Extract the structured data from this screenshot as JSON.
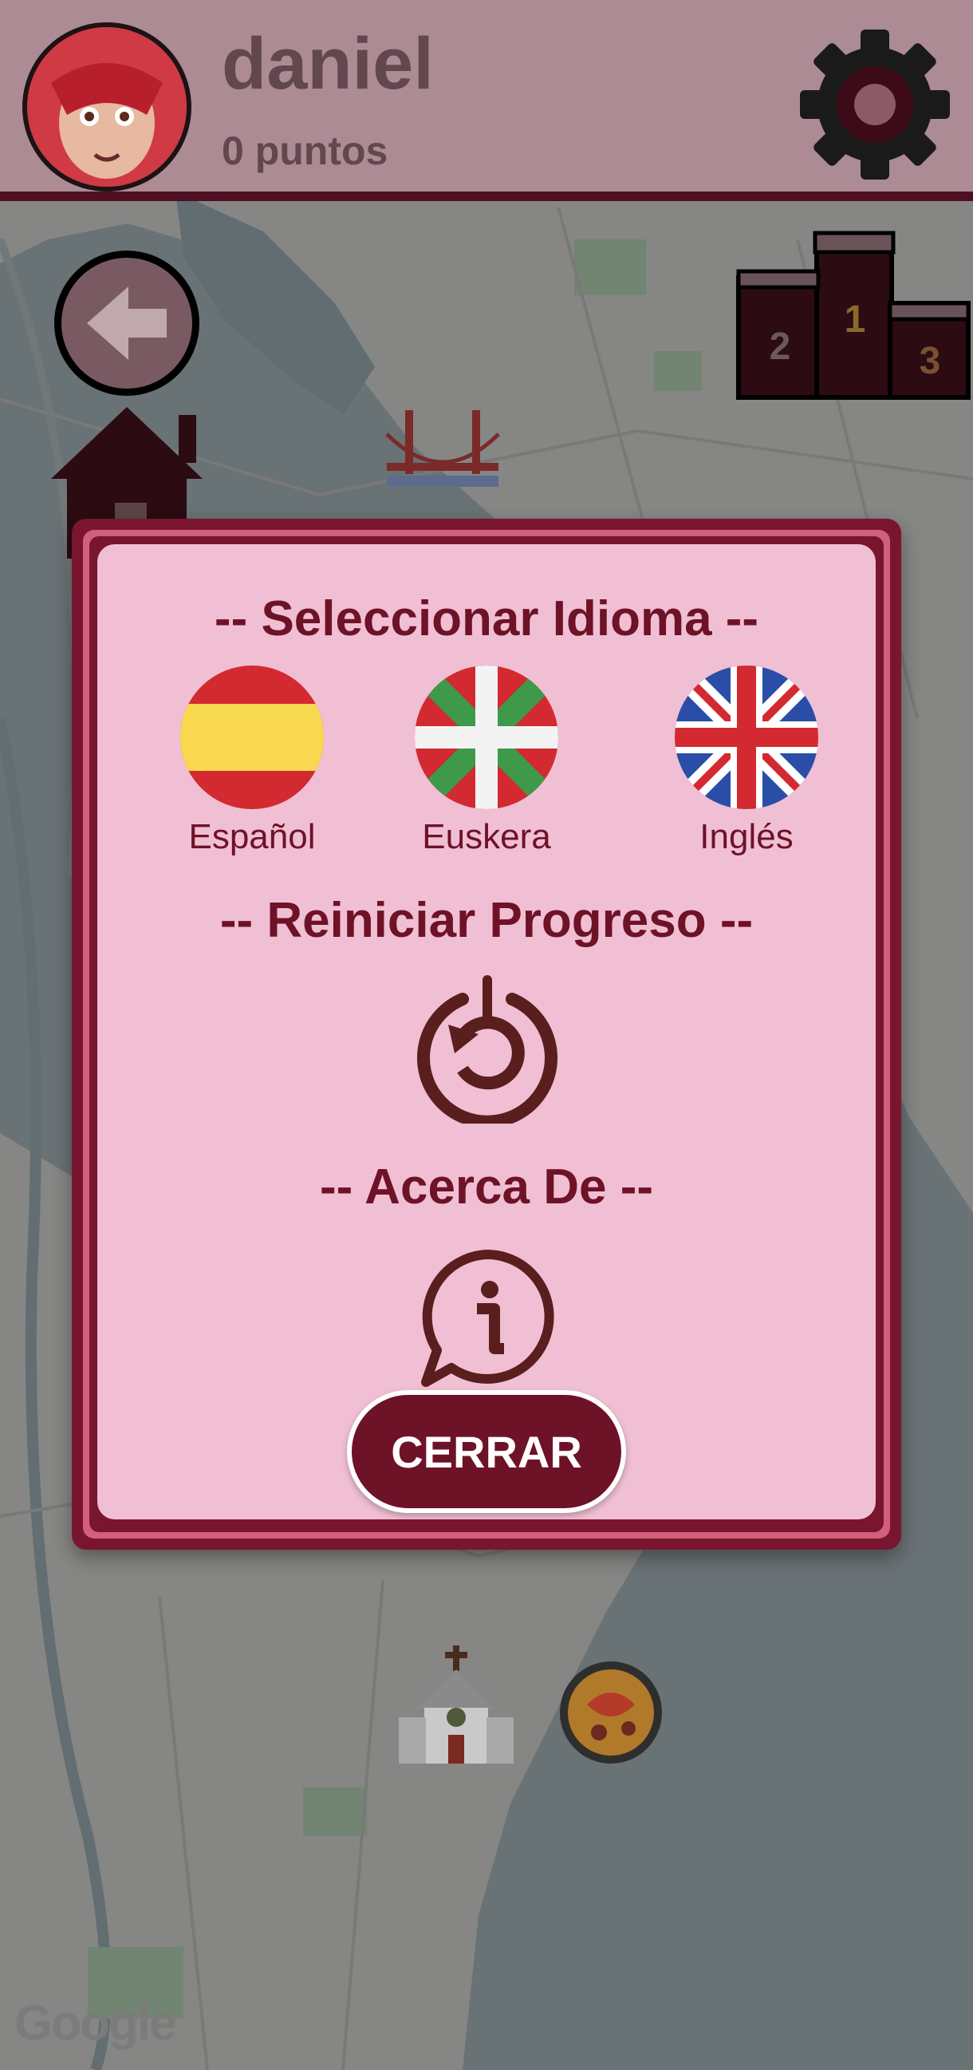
{
  "header": {
    "username": "daniel",
    "points": "0 puntos",
    "avatar": "owlette-avatar",
    "settings_icon": "gear-icon"
  },
  "nav": {
    "back_icon": "arrow-left-icon",
    "ranking_icon": "podium-icon",
    "podium_labels": [
      "1",
      "2",
      "3"
    ]
  },
  "map": {
    "markers": [
      "house-icon",
      "bridge-icon",
      "church-icon",
      "paella-icon"
    ],
    "attribution": "Google"
  },
  "modal": {
    "language_title": "-- Seleccionar Idioma --",
    "languages": [
      {
        "label": "Español",
        "flag": "spain-flag"
      },
      {
        "label": "Euskera",
        "flag": "basque-flag"
      },
      {
        "label": "Inglés",
        "flag": "uk-flag"
      }
    ],
    "reset_title": "-- Reiniciar Progreso --",
    "reset_icon": "reset-icon",
    "about_title": "-- Acerca De --",
    "about_icon": "info-icon",
    "close_label": "CERRAR"
  },
  "colors": {
    "primary": "#6e1228",
    "modal_bg": "#f1bfd3",
    "header_bg": "#ac8b94"
  }
}
